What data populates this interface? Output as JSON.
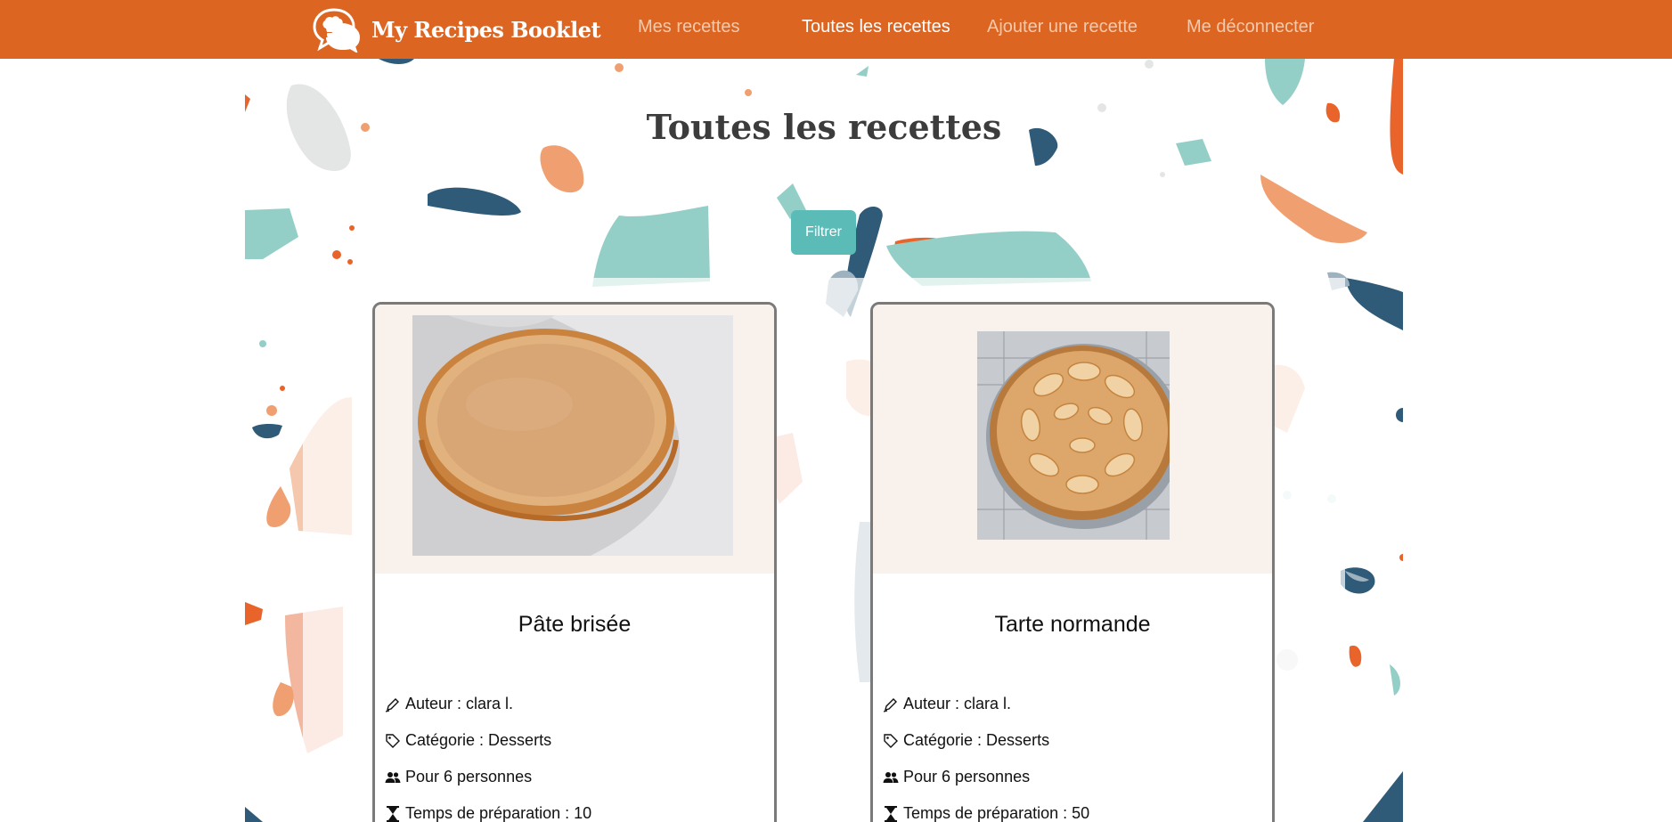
{
  "header": {
    "brand": "My Recipes Booklet",
    "nav": [
      "Mes recettes",
      "Toutes les recettes",
      "Ajouter une recette",
      "Me déconnecter"
    ]
  },
  "page": {
    "title": "Toutes les recettes",
    "filter_label": "Filtrer"
  },
  "recipes": [
    {
      "title": "Pâte brisée",
      "author": "Auteur : clara l.",
      "category": "Catégorie : Desserts",
      "servings": "Pour 6 personnes",
      "prep_time": "Temps de préparation : 10"
    },
    {
      "title": "Tarte normande",
      "author": "Auteur : clara l.",
      "category": "Catégorie : Desserts",
      "servings": "Pour 6 personnes",
      "prep_time": "Temps de préparation : 50"
    }
  ],
  "colors": {
    "header": "#dc6522",
    "accent": "#5bbcb7",
    "navy": "#2f5a78",
    "orange": "#e8642a",
    "peach": "#f0a070"
  },
  "icons": {
    "author": "pen-icon",
    "category": "tag-icon",
    "servings": "people-icon",
    "prep_time": "hourglass-icon"
  }
}
